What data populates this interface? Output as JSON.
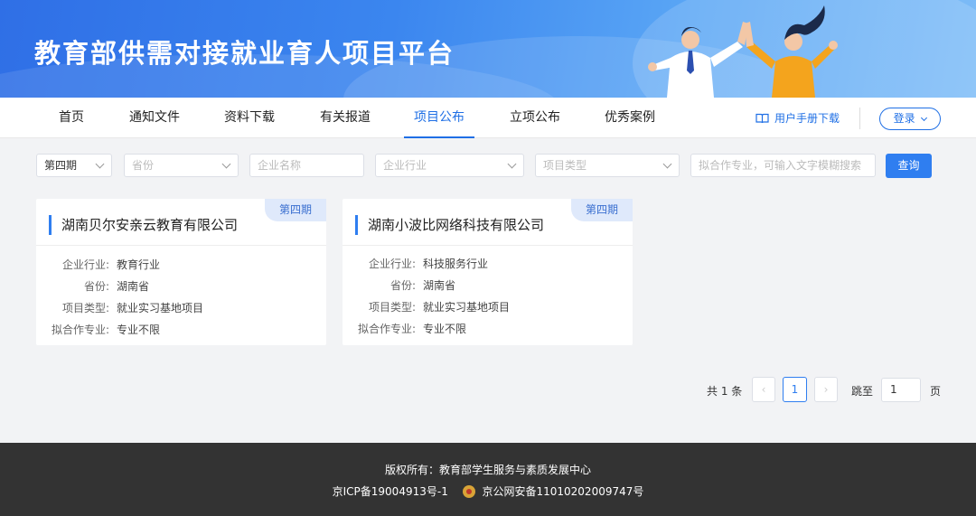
{
  "banner": {
    "title": "教育部供需对接就业育人项目平台"
  },
  "nav": {
    "items": [
      {
        "label": "首页"
      },
      {
        "label": "通知文件"
      },
      {
        "label": "资料下载"
      },
      {
        "label": "有关报道"
      },
      {
        "label": "项目公布",
        "active": true
      },
      {
        "label": "立项公布"
      },
      {
        "label": "优秀案例"
      }
    ],
    "manual_label": "用户手册下载",
    "login_label": "登录"
  },
  "filters": {
    "period_value": "第四期",
    "province_placeholder": "省份",
    "company_placeholder": "企业名称",
    "industry_placeholder": "企业行业",
    "project_type_placeholder": "项目类型",
    "major_placeholder": "拟合作专业，可输入文字模糊搜索",
    "query_label": "查询"
  },
  "cards": [
    {
      "title": "湖南贝尔安亲云教育有限公司",
      "badge": "第四期",
      "rows": [
        {
          "key": "企业行业:",
          "value": "教育行业"
        },
        {
          "key": "省份:",
          "value": "湖南省"
        },
        {
          "key": "项目类型:",
          "value": "就业实习基地项目"
        },
        {
          "key": "拟合作专业:",
          "value": "专业不限"
        }
      ]
    },
    {
      "title": "湖南小波比网络科技有限公司",
      "badge": "第四期",
      "rows": [
        {
          "key": "企业行业:",
          "value": "科技服务行业"
        },
        {
          "key": "省份:",
          "value": "湖南省"
        },
        {
          "key": "项目类型:",
          "value": "就业实习基地项目"
        },
        {
          "key": "拟合作专业:",
          "value": "专业不限"
        }
      ]
    }
  ],
  "pagination": {
    "total": "共 1 条",
    "prev": "‹",
    "current": "1",
    "next": "›",
    "jump_label": "跳至",
    "jump_value": "1",
    "page_label": "页"
  },
  "footer": {
    "copyright": "版权所有：教育部学生服务与素质发展中心",
    "icp": "京ICP备19004913号-1",
    "police": "京公网安备11010202009747号"
  },
  "colors": {
    "accent": "#1f6fe5",
    "banner": "#3b86ef",
    "footer": "#333333"
  }
}
